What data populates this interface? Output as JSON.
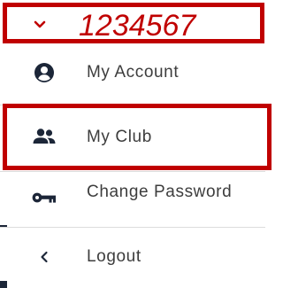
{
  "header": {
    "user_id": "1234567",
    "toggle_icon": "chevron-down-icon",
    "highlight_color": "#c00000"
  },
  "menu": {
    "items": [
      {
        "label": "My Account",
        "icon": "user-circle-icon"
      },
      {
        "label": "My Club",
        "icon": "users-group-icon"
      },
      {
        "label": "Change Password",
        "icon": "key-icon"
      },
      {
        "label": "Logout",
        "icon": "chevron-left-icon"
      }
    ]
  },
  "colors": {
    "text": "#3d3d3d",
    "icon": "#1c2638",
    "annotation": "#c00000"
  }
}
